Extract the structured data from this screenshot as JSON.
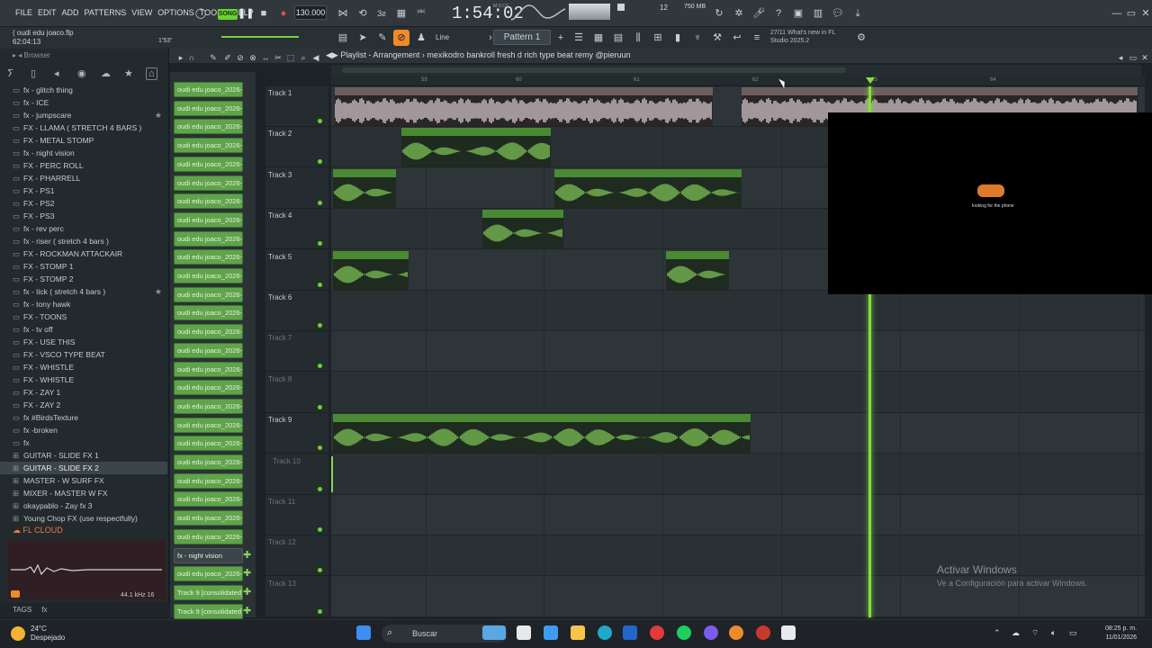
{
  "menu": [
    "FILE",
    "EDIT",
    "ADD",
    "PATTERNS",
    "VIEW",
    "OPTIONS",
    "TOOLS",
    "HELP"
  ],
  "transport": {
    "song_mode": "SONG",
    "bpm": "130.000",
    "time": "1:54:02",
    "time_sub": "M:S:CS",
    "cpu": "12",
    "mem": "750 MB"
  },
  "hint": {
    "line1": "( oudi edu joaco.flp",
    "line2": "62:04:13",
    "line3": "1'53\""
  },
  "toolbar2": {
    "line_label": "Line",
    "pattern_label": "Pattern 1",
    "news": "27/11  What's new in FL Studio 2025.2"
  },
  "browser": {
    "title": "Browser",
    "items": [
      {
        "label": "fx - glitch thing",
        "star": false
      },
      {
        "label": "fx - ICE",
        "star": false
      },
      {
        "label": "fx - jumpscare",
        "star": true
      },
      {
        "label": "FX - LLAMA ( STRETCH 4 BARS )",
        "star": false
      },
      {
        "label": "FX - METAL STOMP",
        "star": false
      },
      {
        "label": "fx - night vision",
        "star": false
      },
      {
        "label": "FX - PERC ROLL",
        "star": false
      },
      {
        "label": "FX - PHARRELL",
        "star": false
      },
      {
        "label": "FX - PS1",
        "star": false
      },
      {
        "label": "FX - PS2",
        "star": false
      },
      {
        "label": "FX - PS3",
        "star": false
      },
      {
        "label": "fx - rev perc",
        "star": false
      },
      {
        "label": "fx - riser ( stretch 4 bars )",
        "star": false
      },
      {
        "label": "FX - ROCKMAN ATTACKAIR",
        "star": false
      },
      {
        "label": "FX - STOMP 1",
        "star": false
      },
      {
        "label": "FX - STOMP 2",
        "star": false
      },
      {
        "label": "fx - tick ( stretch 4 bars )",
        "star": true
      },
      {
        "label": "fx - tony hawk",
        "star": false
      },
      {
        "label": "FX - TOONS",
        "star": false
      },
      {
        "label": "fx - tv off",
        "star": false
      },
      {
        "label": "FX - USE THIS",
        "star": false
      },
      {
        "label": "FX - VSCO TYPE BEAT",
        "star": false
      },
      {
        "label": "FX - WHISTLE",
        "star": false
      },
      {
        "label": "FX - WHISTLE",
        "star": false
      },
      {
        "label": "FX - ZAY 1",
        "star": false
      },
      {
        "label": "FX - ZAY 2",
        "star": false
      },
      {
        "label": "fx #BirdsTexture",
        "star": false
      },
      {
        "label": "fx -broken",
        "star": false
      },
      {
        "label": "fx",
        "star": false
      },
      {
        "label": "GUITAR - SLIDE FX 1",
        "star": false
      },
      {
        "label": "GUITAR - SLIDE FX 2",
        "star": false,
        "selected": true
      },
      {
        "label": "MASTER - W SURF FX",
        "star": false
      },
      {
        "label": "MIXER - MASTER W FX",
        "star": false
      },
      {
        "label": "okaypablo - Zay fx 3",
        "star": false
      },
      {
        "label": "Young Chop FX (use respectfully)",
        "star": false
      }
    ],
    "cloud": "FL CLOUD",
    "khz": "44.1 kHz 16",
    "tags_label": "TAGS",
    "tags_value": "fx"
  },
  "channels": [
    "oudi edu joaco_2026-01...",
    "oudi edu joaco_2026-01...",
    "oudi edu joaco_2026-01...",
    "oudi edu joaco_2026-01...",
    "oudi edu joaco_2026-01...",
    "oudi edu joaco_2026-01...",
    "oudi edu joaco_2026-01...",
    "oudi edu joaco_2026-01...",
    "oudi edu joaco_2026-01...",
    "oudi edu joaco_2026-01...",
    "oudi edu joaco_2026-01...",
    "oudi edu joaco_2026-01...",
    "oudi edu joaco_2026-01...",
    "oudi edu joaco_2026-01...",
    "oudi edu joaco_2026-01...",
    "oudi edu joaco_2026-01...",
    "oudi edu joaco_2026-01...",
    "oudi edu joaco_2026-01...",
    "oudi edu joaco_2026-01...",
    "oudi edu joaco_2026-01...",
    "oudi edu joaco_2026-01...",
    "oudi edu joaco_2026-01...",
    "oudi edu joaco_2026-01...",
    "oudi edu joaco_2026-01...",
    "oudi edu joaco_2026-01...",
    "fx - night vision",
    "oudi edu joaco_2026-01...",
    "Track 9 [consolidated]",
    "Track 9 [consolidated]..."
  ],
  "playlist": {
    "title": "Playlist - Arrangement",
    "pattern": "mexikodro  bankroll fresh  d rich type beat remy @pieruun",
    "ruler": [
      "59",
      "60",
      "61",
      "62",
      "63",
      "64"
    ],
    "tracks": [
      "Track 1",
      "Track 2",
      "Track 3",
      "Track 4",
      "Track 5",
      "Track 6",
      "Track 7",
      "Track 8",
      "Track 9",
      "Track 10",
      "Track 11",
      "Track 12",
      "Track 13"
    ],
    "clips": [
      "mexikodro  bankroll fresh  d rich type beat remy @pieruun",
      "mexikodro  bankroll fresh  d rich type beat remy @pieruun",
      "oudi edu joaco_2026-01-11 19-48-19_2024",
      "oudi edu...-05_2024",
      "oudi edu joaco_2026-01-11 19-49-38_2024",
      "oudi edu jo...-59-07_2024",
      "oudi edu j...56-33_2024",
      "oudi edu...-20_2024",
      "Track 9 [consolidated] #2"
    ]
  },
  "video": {
    "caption": "looking for the phone"
  },
  "watermark": {
    "title": "Activar Windows",
    "sub": "Ve a Configuración para activar Windows."
  },
  "taskbar": {
    "temp": "24°C",
    "weather": "Despejado",
    "search": "Buscar",
    "time": "08:25 p. m.",
    "date": "11/01/2026"
  }
}
